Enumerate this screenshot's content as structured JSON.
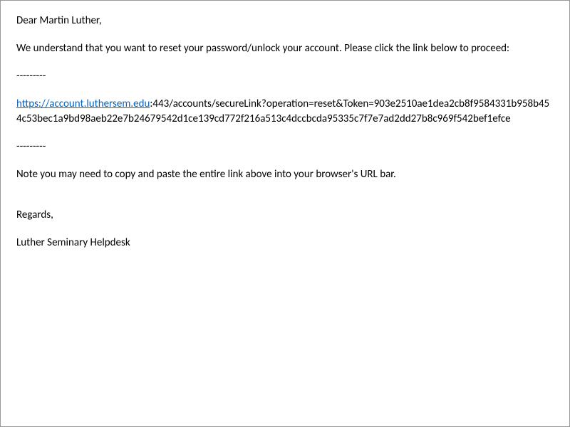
{
  "email": {
    "greeting": "Dear Martin Luther,",
    "intro": "We understand that you want to reset your password/unlock your account.  Please click the link below to proceed:",
    "separator1": "---------",
    "link_visible": "https://account.luthersem.edu",
    "url_rest": ":443/accounts/secureLink?operation=reset&Token=903e2510ae1dea2cb8f9584331b958b454c53bec1a9bd98aeb22e7b24679542d1ce139cd772f216a513c4dccbcda95335c7f7e7ad2dd27b8c969f542bef1efce",
    "separator2": "---------",
    "note": "Note you may need to copy and paste the entire link above into your browser's URL bar.",
    "regards": "Regards,",
    "signature": "Luther Seminary Helpdesk"
  }
}
